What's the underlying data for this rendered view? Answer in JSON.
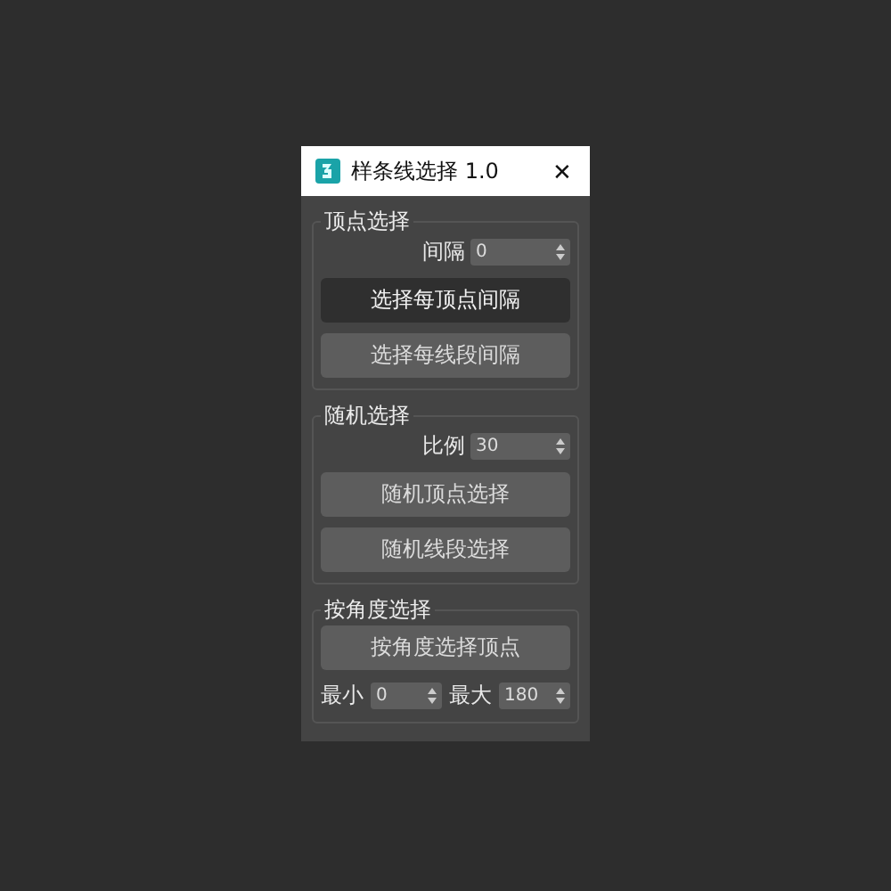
{
  "window": {
    "title": "样条线选择 1.0",
    "close": "✕"
  },
  "groups": [
    {
      "title": "顶点选择",
      "rows": [
        {
          "kind": "spinner",
          "label": "间隔",
          "value": "0"
        },
        {
          "kind": "button",
          "label": "选择每顶点间隔",
          "pressed": true
        },
        {
          "kind": "button",
          "label": "选择每线段间隔",
          "pressed": false
        }
      ]
    },
    {
      "title": "随机选择",
      "rows": [
        {
          "kind": "spinner",
          "label": "比例",
          "value": "30"
        },
        {
          "kind": "button",
          "label": "随机顶点选择",
          "pressed": false
        },
        {
          "kind": "button",
          "label": "随机线段选择",
          "pressed": false
        }
      ]
    },
    {
      "title": "按角度选择",
      "rows": [
        {
          "kind": "button",
          "label": "按角度选择顶点",
          "pressed": false
        },
        {
          "kind": "pair",
          "items": [
            {
              "label": "最小",
              "value": "0"
            },
            {
              "label": "最大",
              "value": "180"
            }
          ]
        }
      ]
    }
  ]
}
